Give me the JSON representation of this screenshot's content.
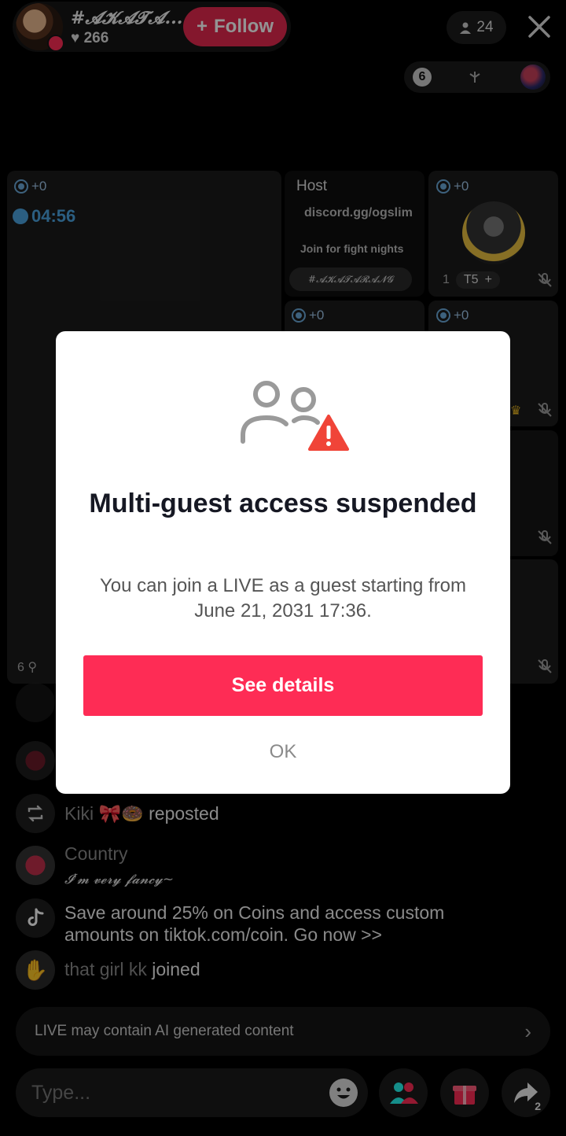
{
  "header": {
    "host_name": "#𝓐𝓚𝓐𝓣𝓐...",
    "likes": "266",
    "follow_label": "Follow",
    "viewer_count": "24"
  },
  "ranking": {
    "number": "6"
  },
  "grid": {
    "big_tile": {
      "tag": "+0",
      "timer": "04:56",
      "footer_num": "6"
    },
    "host_tile": {
      "label": "Host",
      "line1": "discord.gg/ogslim",
      "line2": "Join for fight nights",
      "tag": "#𝓐𝓚𝓐𝓣𝓐𝓡𝓐𝓝𝓖"
    },
    "guest_tile_1": {
      "tag": "+0",
      "rank": "1",
      "badge": "T5"
    },
    "guest_tile_2": {
      "tag": "+0"
    },
    "guest_tile_3": {
      "tag": "+0"
    }
  },
  "chat": [
    {
      "type": "repost",
      "user": "Kiki 🎀🍩",
      "text": "reposted"
    },
    {
      "type": "comment",
      "user": "Country",
      "text": "𝓘'𝓶 𝓿𝓮𝓻𝔂 𝓯𝓪𝓷𝓬𝔂~"
    },
    {
      "type": "system",
      "text": "Save around 25% on Coins and access custom amounts on tiktok.com/coin. Go now >>"
    },
    {
      "type": "join",
      "user": "that girl kk",
      "text": "joined"
    }
  ],
  "ai_notice": "LIVE may contain AI generated content",
  "input": {
    "placeholder": "Type..."
  },
  "share_count": "2",
  "modal": {
    "title": "Multi-guest access suspended",
    "body": "You can join a LIVE as a guest starting from June 21, 2031 17:36.",
    "primary_label": "See details",
    "secondary_label": "OK"
  },
  "colors": {
    "accent": "#fe2c55",
    "follow": "#e3294f",
    "timer": "#4aa3df",
    "warning": "#f04438"
  }
}
